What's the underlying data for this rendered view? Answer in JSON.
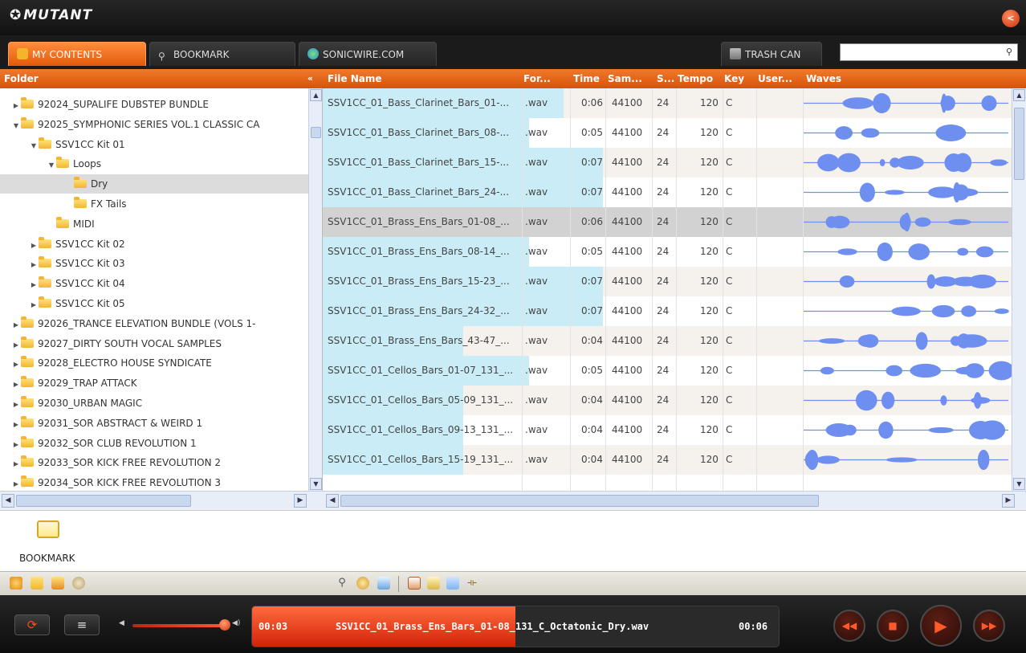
{
  "app": {
    "title": "MUTANT",
    "title_symbol": "✪"
  },
  "tabs": [
    {
      "label": "MY CONTENTS",
      "active": true
    },
    {
      "label": "BOOKMARK",
      "active": false
    },
    {
      "label": "SONICWIRE.COM",
      "active": false
    },
    {
      "label": "TRASH CAN",
      "active": false
    }
  ],
  "search": {
    "value": "",
    "icon": "search-icon"
  },
  "folder_panel": {
    "header": "Folder",
    "collapse_label": "«",
    "items": [
      {
        "label": "92024_SUPALIFE DUBSTEP BUNDLE",
        "arrow": "▶",
        "depth": 0
      },
      {
        "label": "92025_SYMPHONIC SERIES VOL.1 CLASSIC CA",
        "arrow": "▼",
        "depth": 0
      },
      {
        "label": "SSV1CC Kit 01",
        "arrow": "▼",
        "depth": 1
      },
      {
        "label": "Loops",
        "arrow": "▼",
        "depth": 2
      },
      {
        "label": "Dry",
        "arrow": "",
        "depth": 3,
        "selected": true
      },
      {
        "label": "FX Tails",
        "arrow": "",
        "depth": 3
      },
      {
        "label": "MIDI",
        "arrow": "",
        "depth": 2
      },
      {
        "label": "SSV1CC Kit 02",
        "arrow": "▶",
        "depth": 1
      },
      {
        "label": "SSV1CC Kit 03",
        "arrow": "▶",
        "depth": 1
      },
      {
        "label": "SSV1CC Kit 04",
        "arrow": "▶",
        "depth": 1
      },
      {
        "label": "SSV1CC Kit 05",
        "arrow": "▶",
        "depth": 1
      },
      {
        "label": "92026_TRANCE ELEVATION BUNDLE (VOLS 1-",
        "arrow": "▶",
        "depth": 0
      },
      {
        "label": "92027_DIRTY SOUTH VOCAL SAMPLES",
        "arrow": "▶",
        "depth": 0
      },
      {
        "label": "92028_ELECTRO HOUSE SYNDICATE",
        "arrow": "▶",
        "depth": 0
      },
      {
        "label": "92029_TRAP ATTACK",
        "arrow": "▶",
        "depth": 0
      },
      {
        "label": "92030_URBAN MAGIC",
        "arrow": "▶",
        "depth": 0
      },
      {
        "label": "92031_SOR ABSTRACT & WEIRD 1",
        "arrow": "▶",
        "depth": 0
      },
      {
        "label": "92032_SOR CLUB REVOLUTION 1",
        "arrow": "▶",
        "depth": 0
      },
      {
        "label": "92033_SOR KICK FREE REVOLUTION 2",
        "arrow": "▶",
        "depth": 0
      },
      {
        "label": "92034_SOR KICK FREE REVOLUTION 3",
        "arrow": "▶",
        "depth": 0
      }
    ]
  },
  "file_columns": [
    "File Name",
    "For...",
    "Time",
    "Sam...",
    "S...",
    "Tempo",
    "Key",
    "User...",
    "Waves"
  ],
  "files": [
    {
      "name": "SSV1CC_01_Bass_Clarinet_Bars_01-...",
      "format": ".wav",
      "time": "0:06",
      "sample_rate": "44100",
      "bits": "24",
      "tempo": "120",
      "key": "C",
      "user": "",
      "progress": 0.55
    },
    {
      "name": "SSV1CC_01_Bass_Clarinet_Bars_08-...",
      "format": ".wav",
      "time": "0:05",
      "sample_rate": "44100",
      "bits": "24",
      "tempo": "120",
      "key": "C",
      "user": "",
      "progress": 0.47
    },
    {
      "name": "SSV1CC_01_Bass_Clarinet_Bars_15-...",
      "format": ".wav",
      "time": "0:07",
      "sample_rate": "44100",
      "bits": "24",
      "tempo": "120",
      "key": "C",
      "user": "",
      "progress": 0.64
    },
    {
      "name": "SSV1CC_01_Bass_Clarinet_Bars_24-...",
      "format": ".wav",
      "time": "0:07",
      "sample_rate": "44100",
      "bits": "24",
      "tempo": "120",
      "key": "C",
      "user": "",
      "progress": 0.64
    },
    {
      "name": "SSV1CC_01_Brass_Ens_Bars_01-08_...",
      "format": ".wav",
      "time": "0:06",
      "sample_rate": "44100",
      "bits": "24",
      "tempo": "120",
      "key": "C",
      "user": "",
      "progress": 0.55
    },
    {
      "name": "SSV1CC_01_Brass_Ens_Bars_08-14_...",
      "format": ".wav",
      "time": "0:05",
      "sample_rate": "44100",
      "bits": "24",
      "tempo": "120",
      "key": "C",
      "user": "",
      "progress": 0.47
    },
    {
      "name": "SSV1CC_01_Brass_Ens_Bars_15-23_...",
      "format": ".wav",
      "time": "0:07",
      "sample_rate": "44100",
      "bits": "24",
      "tempo": "120",
      "key": "C",
      "user": "",
      "progress": 0.64
    },
    {
      "name": "SSV1CC_01_Brass_Ens_Bars_24-32_...",
      "format": ".wav",
      "time": "0:07",
      "sample_rate": "44100",
      "bits": "24",
      "tempo": "120",
      "key": "C",
      "user": "",
      "progress": 0.64
    },
    {
      "name": "SSV1CC_01_Brass_Ens_Bars_43-47_...",
      "format": ".wav",
      "time": "0:04",
      "sample_rate": "44100",
      "bits": "24",
      "tempo": "120",
      "key": "C",
      "user": "",
      "progress": 0.32
    },
    {
      "name": "SSV1CC_01_Cellos_Bars_01-07_131_...",
      "format": ".wav",
      "time": "0:05",
      "sample_rate": "44100",
      "bits": "24",
      "tempo": "120",
      "key": "C",
      "user": "",
      "progress": 0.47
    },
    {
      "name": "SSV1CC_01_Cellos_Bars_05-09_131_...",
      "format": ".wav",
      "time": "0:04",
      "sample_rate": "44100",
      "bits": "24",
      "tempo": "120",
      "key": "C",
      "user": "",
      "progress": 0.32
    },
    {
      "name": "SSV1CC_01_Cellos_Bars_09-13_131_...",
      "format": ".wav",
      "time": "0:04",
      "sample_rate": "44100",
      "bits": "24",
      "tempo": "120",
      "key": "C",
      "user": "",
      "progress": 0.32
    },
    {
      "name": "SSV1CC_01_Cellos_Bars_15-19_131_...",
      "format": ".wav",
      "time": "0:04",
      "sample_rate": "44100",
      "bits": "24",
      "tempo": "120",
      "key": "C",
      "user": "",
      "progress": 0.32
    }
  ],
  "bookmark_area": {
    "label": "BOOKMARK"
  },
  "player": {
    "elapsed": "00:03",
    "total": "00:06",
    "now_playing": "SSV1CC_01_Brass_Ens_Bars_01-08_131_C_Octatonic_Dry.wav",
    "progress": 0.5
  },
  "colors": {
    "accent": "#e35a0b",
    "wave": "#6e8ff0",
    "progress": "#c9ecf6",
    "row_alt": "#f5f1ec"
  }
}
